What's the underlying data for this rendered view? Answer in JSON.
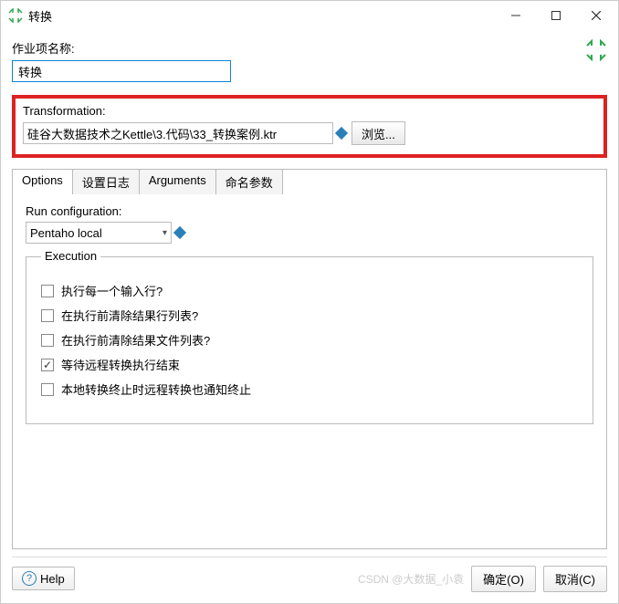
{
  "window": {
    "title": "转换"
  },
  "labels": {
    "job_name": "作业项名称:",
    "transformation": "Transformation:",
    "run_config": "Run configuration:",
    "execution": "Execution"
  },
  "fields": {
    "job_name_value": "转换",
    "transformation_path": "硅谷大数据技术之Kettle\\3.代码\\33_转换案例.ktr",
    "run_config_value": "Pentaho local"
  },
  "buttons": {
    "browse": "浏览...",
    "help": "Help",
    "ok": "确定(O)",
    "cancel": "取消(C)"
  },
  "tabs": [
    {
      "label": "Options"
    },
    {
      "label": "设置日志"
    },
    {
      "label": "Arguments"
    },
    {
      "label": "命名参数"
    }
  ],
  "exec_checks": [
    {
      "label": "执行每一个输入行?",
      "checked": false
    },
    {
      "label": "在执行前清除结果行列表?",
      "checked": false
    },
    {
      "label": "在执行前清除结果文件列表?",
      "checked": false
    },
    {
      "label": "等待远程转换执行结束",
      "checked": true
    },
    {
      "label": "本地转换终止时远程转换也通知终止",
      "checked": false
    }
  ],
  "watermark": "CSDN @大数据_小袁"
}
